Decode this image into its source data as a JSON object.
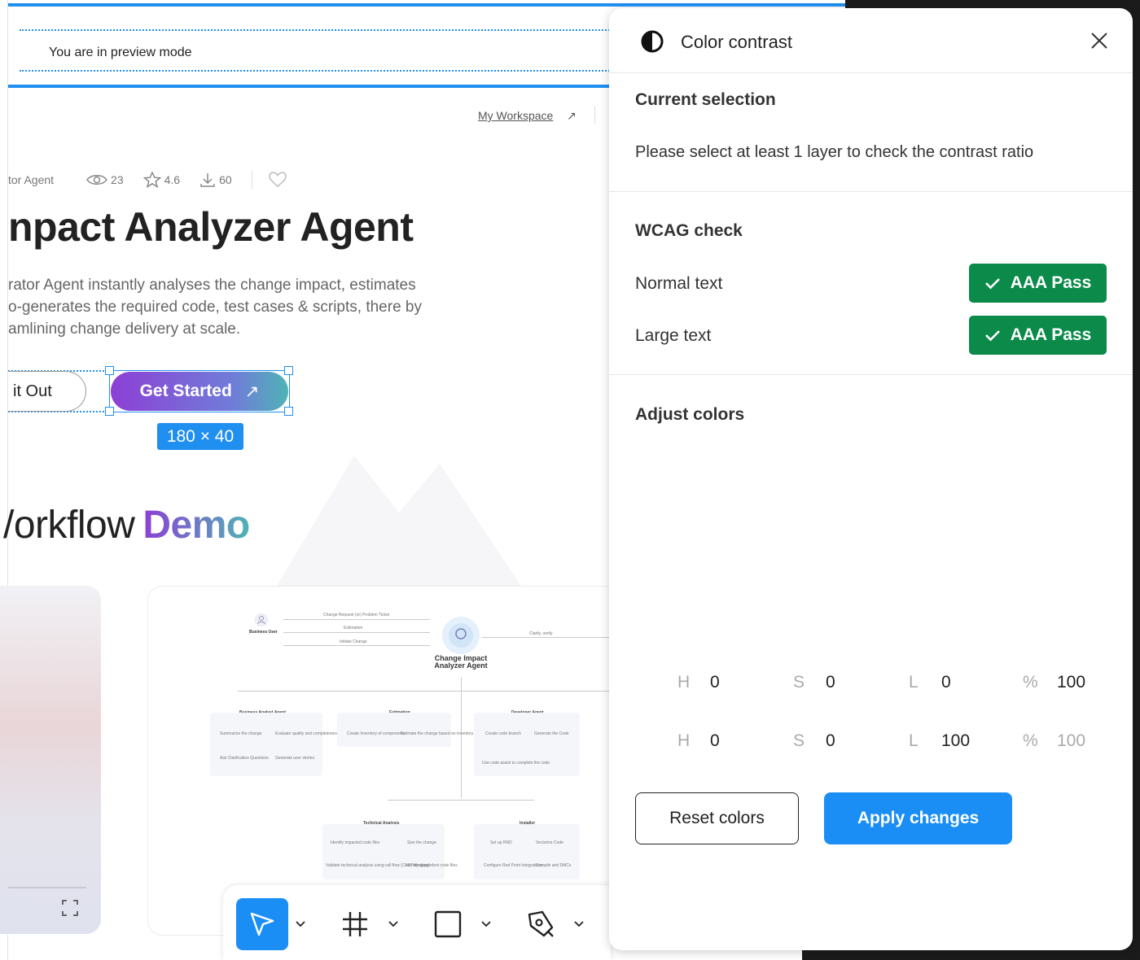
{
  "canvas": {
    "preview_banner": "You are in preview mode",
    "workspace_link": "My Workspace",
    "workspace_arrow": "↗",
    "meta": {
      "category": "tor Agent",
      "views": "23",
      "rating": "4.6",
      "downloads": "60"
    },
    "hero_title": "npact Analyzer Agent",
    "hero_desc": [
      "rator Agent instantly analyses the change impact, estimates",
      "o-generates the required code, test cases & scripts, there by",
      "amlining change delivery at scale."
    ],
    "try_button": "it Out",
    "get_started": "Get Started",
    "get_started_arrow": "↗",
    "size_badge": "180 × 40",
    "workflow_prefix": "/orkflow",
    "workflow_accent": "Demo",
    "diagram": {
      "agent_title": "Change Impact Analyzer Agent",
      "user_label": "Business User",
      "msg1": "Change Request (or) Problem Ticket",
      "msg2": "Estimation",
      "msg3": "Initiate Change",
      "msg4": "Clarify, verify",
      "ba_title": "Business Analyst Agent",
      "ba_items": [
        "Summarize the change",
        "Evaluate quality and completeness",
        "Ask Clarification Questions",
        "Generate user stories"
      ],
      "est_title": "Estimation",
      "est_items": [
        "Create Inventory of components",
        "Estimate the change based on inventory"
      ],
      "dev_title": "Developer Agent",
      "dev_items": [
        "Create code branch",
        "Generate the Code",
        "Use code assist to complete the code"
      ],
      "tech_title": "Technical Analysis",
      "tech_items": [
        "Identify impacted code files",
        "Size the change",
        "Validate technical analysis using call flow (CAST imaging)",
        "Identify dependent code files"
      ],
      "inst_title": "Installer",
      "inst_items": [
        "Set up RND",
        "Vectorize Code",
        "Configure Red Point Integrations",
        "Compile and DMCs"
      ]
    },
    "toolbar": {
      "tools": [
        "move-tool",
        "frame-tool",
        "rectangle-tool",
        "pen-tool"
      ],
      "accent": "#1a8ef5"
    }
  },
  "panel": {
    "title": "Color contrast",
    "current_selection": {
      "heading": "Current selection",
      "note": "Please select at least 1 layer to check the contrast ratio"
    },
    "wcag": {
      "heading": "WCAG check",
      "rows": [
        {
          "label": "Normal text",
          "badge": "AAA Pass"
        },
        {
          "label": "Large text",
          "badge": "AAA Pass"
        }
      ],
      "pass_color": "#0b8a4a"
    },
    "adjust": {
      "heading": "Adjust colors",
      "foreground": {
        "h_label": "H",
        "h": "0",
        "s_label": "S",
        "s": "0",
        "l_label": "L",
        "l": "0",
        "pct_label": "%",
        "pct": "100"
      },
      "background": {
        "h_label": "H",
        "h": "0",
        "s_label": "S",
        "s": "0",
        "l_label": "L",
        "l": "100",
        "pct_label": "%",
        "pct": "100"
      }
    },
    "reset_label": "Reset colors",
    "apply_label": "Apply changes"
  }
}
